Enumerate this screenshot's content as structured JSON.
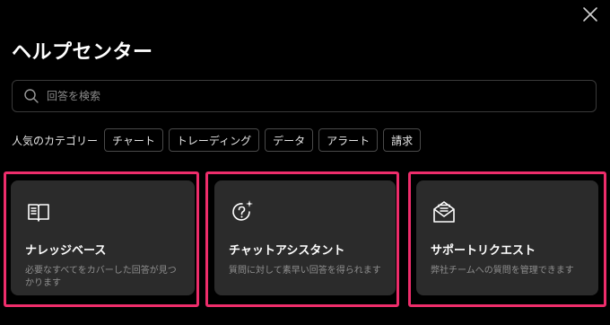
{
  "title": "ヘルプセンター",
  "search": {
    "placeholder": "回答を検索",
    "icon": "search-icon"
  },
  "popular": {
    "label": "人気のカテゴリー",
    "chips": [
      "チャート",
      "トレーディング",
      "データ",
      "アラート",
      "請求"
    ]
  },
  "cards": [
    {
      "title": "ナレッジベース",
      "description": "必要なすべてをカバーした回答が見つかります",
      "icon": "book-icon"
    },
    {
      "title": "チャットアシスタント",
      "description": "質問に対して素早い回答を得られます",
      "icon": "question-sparkle-icon"
    },
    {
      "title": "サポートリクエスト",
      "description": "弊社チームへの質問を管理できます",
      "icon": "envelope-icon"
    }
  ],
  "colors": {
    "background": "#000000",
    "card": "#2b2b2b",
    "highlight": "#ee2d6b"
  }
}
